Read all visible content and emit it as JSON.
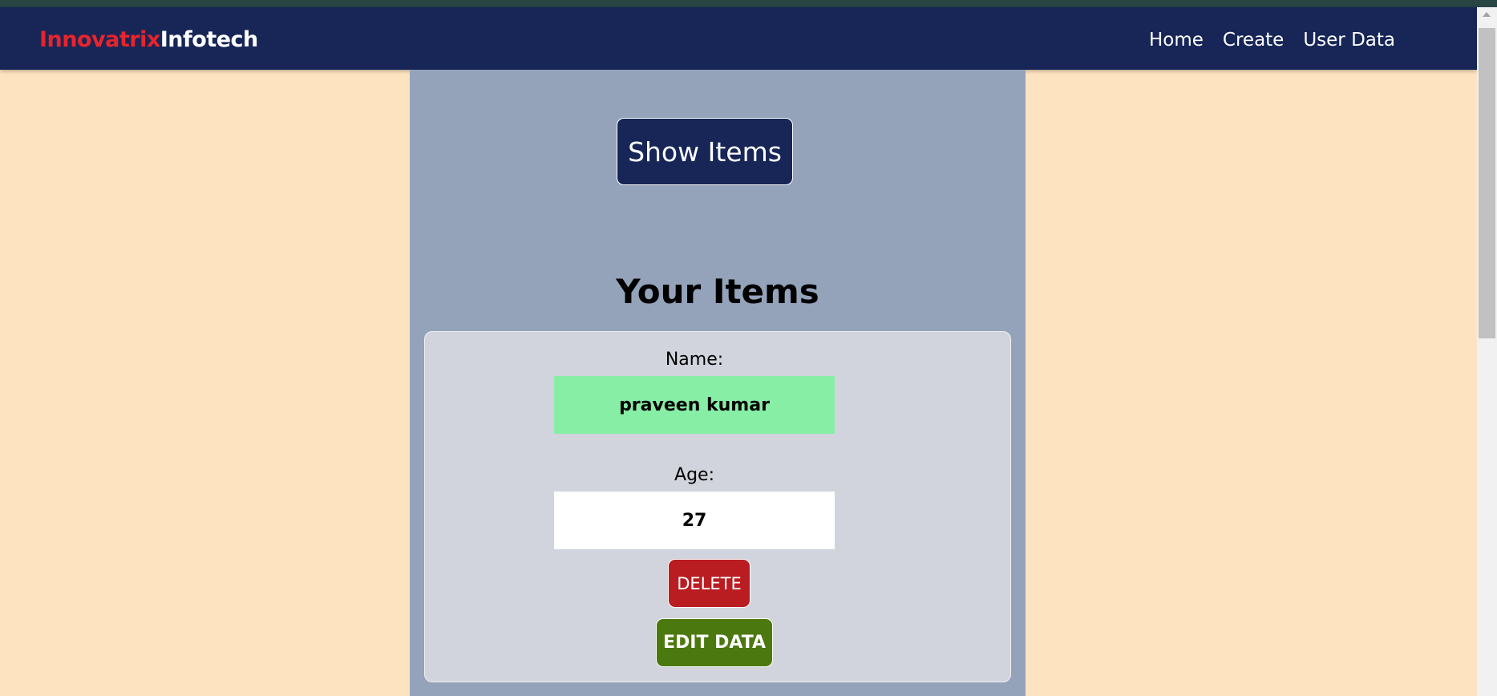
{
  "navbar": {
    "brand_part1": "Innovatrix",
    "brand_part2": "Infotech",
    "links": [
      "Home",
      "Create",
      "User Data"
    ]
  },
  "main": {
    "show_button_label": "Show Items",
    "section_title": "Your Items",
    "item": {
      "name_label": "Name:",
      "name_value": "praveen kumar",
      "age_label": "Age:",
      "age_value": "27",
      "delete_label": "DELETE",
      "edit_label": "EDIT DATA"
    }
  },
  "colors": {
    "page_bg": "#fee3c1",
    "navbar_bg": "#172657",
    "brand_accent": "#e8242b",
    "panel_bg": "#94a3ba",
    "card_bg": "#d1d4dc",
    "name_field_bg": "#87eea6",
    "delete_bg": "#b91d22",
    "edit_bg": "#4b780f"
  }
}
